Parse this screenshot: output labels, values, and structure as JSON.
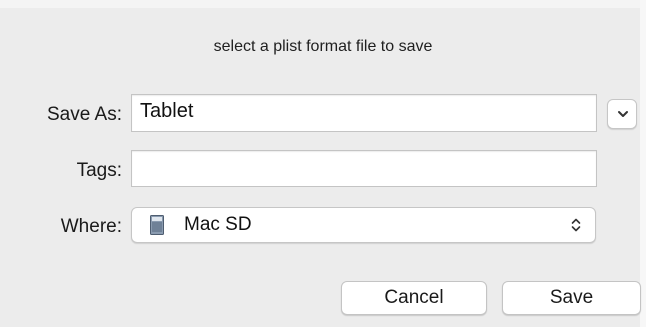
{
  "dialog": {
    "prompt": "select a plist format file to save",
    "save_as": {
      "label": "Save As:",
      "value": "Tablet"
    },
    "tags": {
      "label": "Tags:",
      "value": ""
    },
    "where": {
      "label": "Where:",
      "selected": "Mac SD",
      "icon": "disk-icon"
    },
    "expand_button_icon": "chevron-down-icon",
    "buttons": {
      "cancel": "Cancel",
      "save": "Save"
    }
  }
}
